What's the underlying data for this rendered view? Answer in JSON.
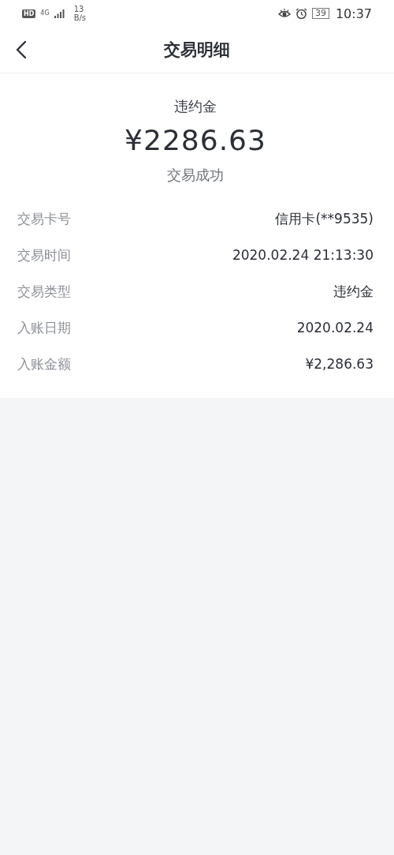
{
  "status_bar": {
    "hd": "HD",
    "network": "4G",
    "speed_value": "13",
    "speed_unit": "B/s",
    "battery": "39",
    "time": "10:37"
  },
  "header": {
    "title": "交易明细"
  },
  "summary": {
    "type": "违约金",
    "amount": "¥2286.63",
    "status": "交易成功"
  },
  "details": [
    {
      "label": "交易卡号",
      "value": "信用卡(**9535)"
    },
    {
      "label": "交易时间",
      "value": "2020.02.24 21:13:30"
    },
    {
      "label": "交易类型",
      "value": "违约金"
    },
    {
      "label": "入账日期",
      "value": "2020.02.24"
    },
    {
      "label": "入账金额",
      "value": "¥2,286.63"
    }
  ]
}
